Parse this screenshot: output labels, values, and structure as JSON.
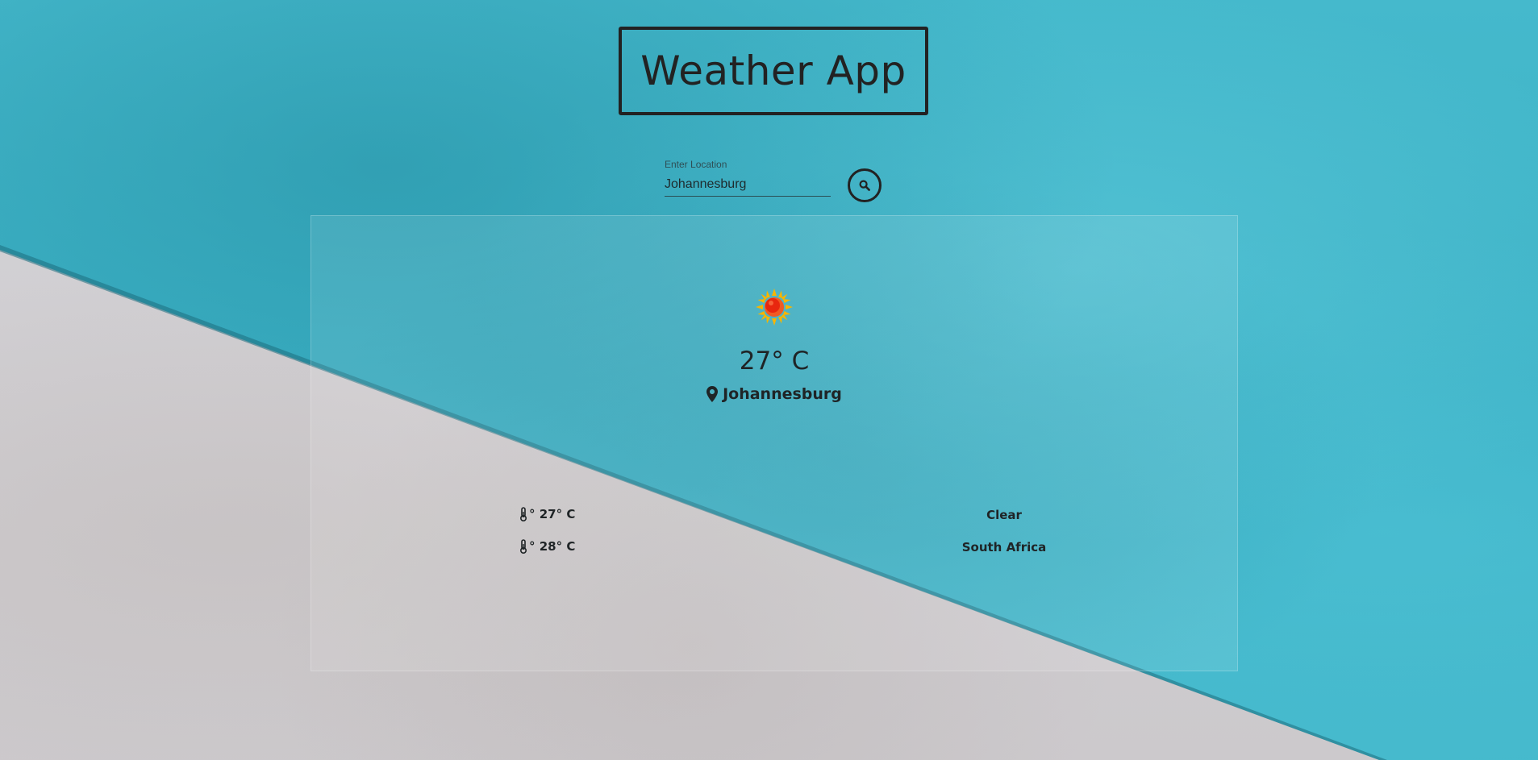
{
  "header": {
    "title": "Weather App"
  },
  "search": {
    "label": "Enter Location",
    "value": "Johannesburg",
    "button_icon": "search-icon"
  },
  "weather": {
    "condition_icon": "sun-icon",
    "temperature": "27° C",
    "location_icon": "map-marker-icon",
    "location": "Johannesburg",
    "min_temp_icon": "thermometer-icon",
    "min_temp": "° 27° C",
    "max_temp_icon": "thermometer-icon",
    "max_temp": "° 28° C",
    "condition": "Clear",
    "country": "South Africa"
  },
  "colors": {
    "text": "#1f2426",
    "water": "#3fb6c9",
    "concrete": "#d0cfd2"
  }
}
